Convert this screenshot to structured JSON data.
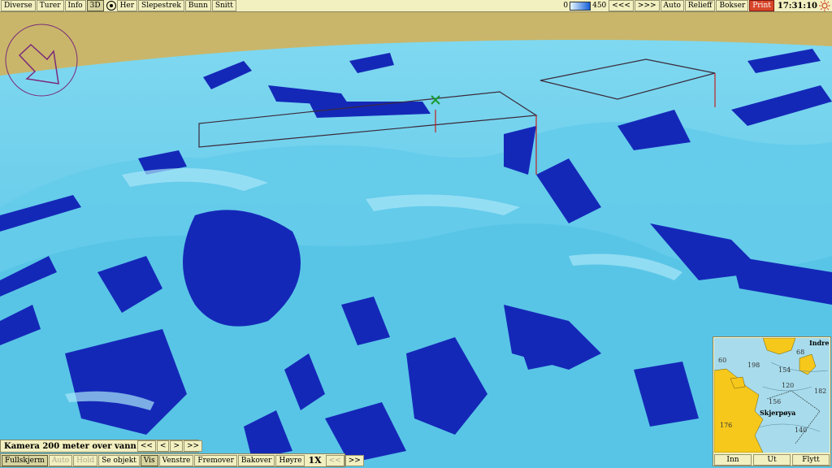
{
  "toolbar": {
    "left_items": [
      {
        "label": "Diverse"
      },
      {
        "label": "Turer"
      },
      {
        "label": "Info"
      },
      {
        "label": "3D",
        "active": true
      },
      {
        "label": "Her"
      },
      {
        "label": "Slepestrek"
      },
      {
        "label": "Bunn"
      },
      {
        "label": "Snitt"
      }
    ],
    "depth_scale": {
      "min": "0",
      "max": "450"
    },
    "right_items": [
      {
        "label": "<<<"
      },
      {
        "label": ">>>"
      },
      {
        "label": "Auto"
      },
      {
        "label": "Relieff"
      },
      {
        "label": "Bokser"
      },
      {
        "label": "Print"
      }
    ],
    "time": "17:31:10",
    "icons": {
      "target": "target-icon",
      "sun": "sun-icon"
    }
  },
  "camera_panel": {
    "label": "Kamera 200 meter over vann",
    "buttons": [
      "<<",
      "<",
      ">",
      ">>"
    ]
  },
  "nav_panel": {
    "buttons": [
      "Fullskjerm",
      "Auto",
      "Hold",
      "Se objekt",
      "Vis",
      "Venstre",
      "Fremover",
      "Bakover",
      "Høyre"
    ],
    "speed": "1X",
    "speed_buttons": [
      "<<",
      ">>"
    ]
  },
  "minimap": {
    "labels": {
      "island": "Skjerpøya",
      "corner": "Indre"
    },
    "depths": [
      "60",
      "198",
      "68",
      "154",
      "120",
      "182",
      "156",
      "140",
      "176"
    ],
    "buttons": [
      "Inn",
      "Ut",
      "Flytt"
    ]
  },
  "colors": {
    "sky": "#c9b66a",
    "water": "#5fc6e8",
    "deep": "#1428b8",
    "land": "#f6c81c",
    "chrome": "#f2f0c0"
  }
}
